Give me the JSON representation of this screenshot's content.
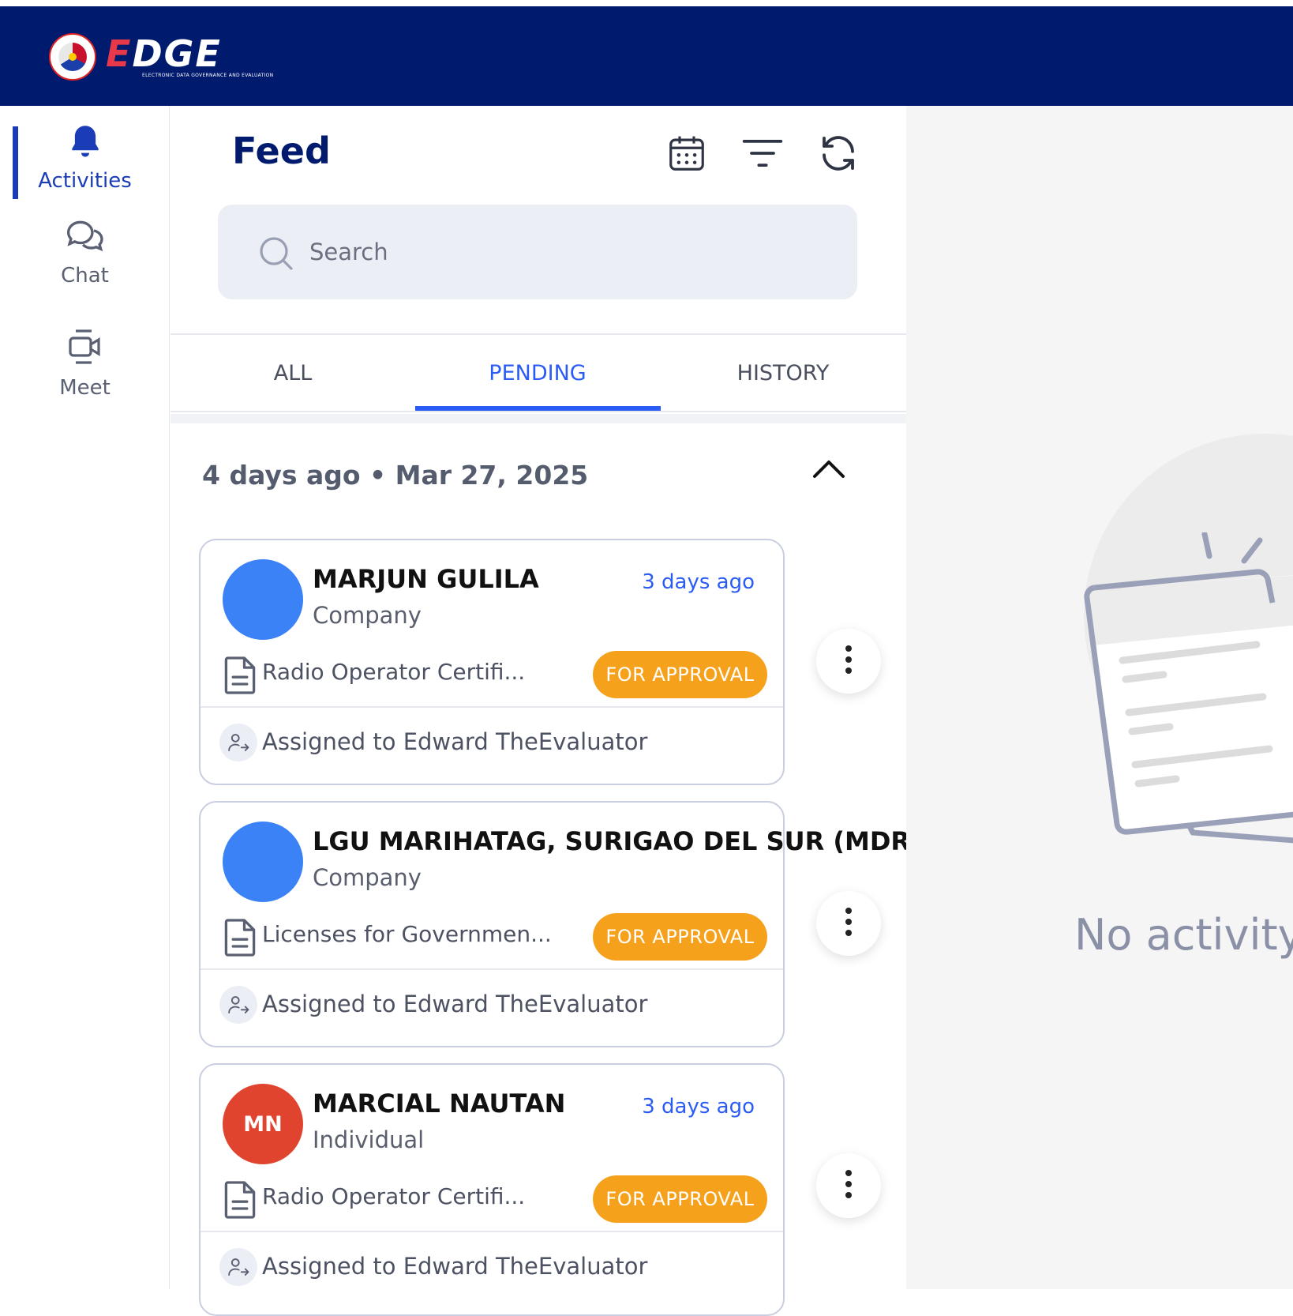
{
  "brand": {
    "name": "EDGE",
    "tagline": "ELECTRONIC DATA GOVERNANCE AND EVALUATION",
    "primary_color": "#001a6e",
    "accent_color": "#2a5cf5"
  },
  "sidebar": {
    "items": [
      {
        "label": "Activities",
        "icon": "bell-icon",
        "active": true
      },
      {
        "label": "Chat",
        "icon": "chat-bubbles-icon",
        "active": false
      },
      {
        "label": "Meet",
        "icon": "video-camera-icon",
        "active": false
      }
    ]
  },
  "feed": {
    "title": "Feed",
    "tools": [
      "calendar-icon",
      "filter-icon",
      "refresh-icon"
    ],
    "search": {
      "placeholder": "Search",
      "value": ""
    },
    "tabs": [
      {
        "label": "ALL",
        "active": false
      },
      {
        "label": "PENDING",
        "active": true
      },
      {
        "label": "HISTORY",
        "active": false
      }
    ],
    "group": {
      "label": "4 days ago • Mar 27, 2025",
      "expanded": true
    },
    "cards": [
      {
        "name": "MARJUN GULILA",
        "type": "Company",
        "time": "3 days ago",
        "document": "Radio Operator Certifi...",
        "status": "FOR APPROVAL",
        "assigned": "Assigned to Edward TheEvaluator",
        "avatar_initials": "",
        "avatar_color": "#3b82f6"
      },
      {
        "name": "LGU MARIHATAG, SURIGAO DEL SUR (MDRRMO",
        "type": "Company",
        "time": "",
        "document": "Licenses for Governmen...",
        "status": "FOR APPROVAL",
        "assigned": "Assigned to Edward TheEvaluator",
        "avatar_initials": "",
        "avatar_color": "#3b82f6"
      },
      {
        "name": "MARCIAL NAUTAN",
        "type": "Individual",
        "time": "3 days ago",
        "document": "Radio Operator Certifi...",
        "status": "FOR APPROVAL",
        "assigned": "Assigned to Edward TheEvaluator",
        "avatar_initials": "MN",
        "avatar_color": "#e0442f"
      }
    ],
    "status_color": "#f6a11c"
  },
  "detail": {
    "empty_text": "No activity"
  }
}
